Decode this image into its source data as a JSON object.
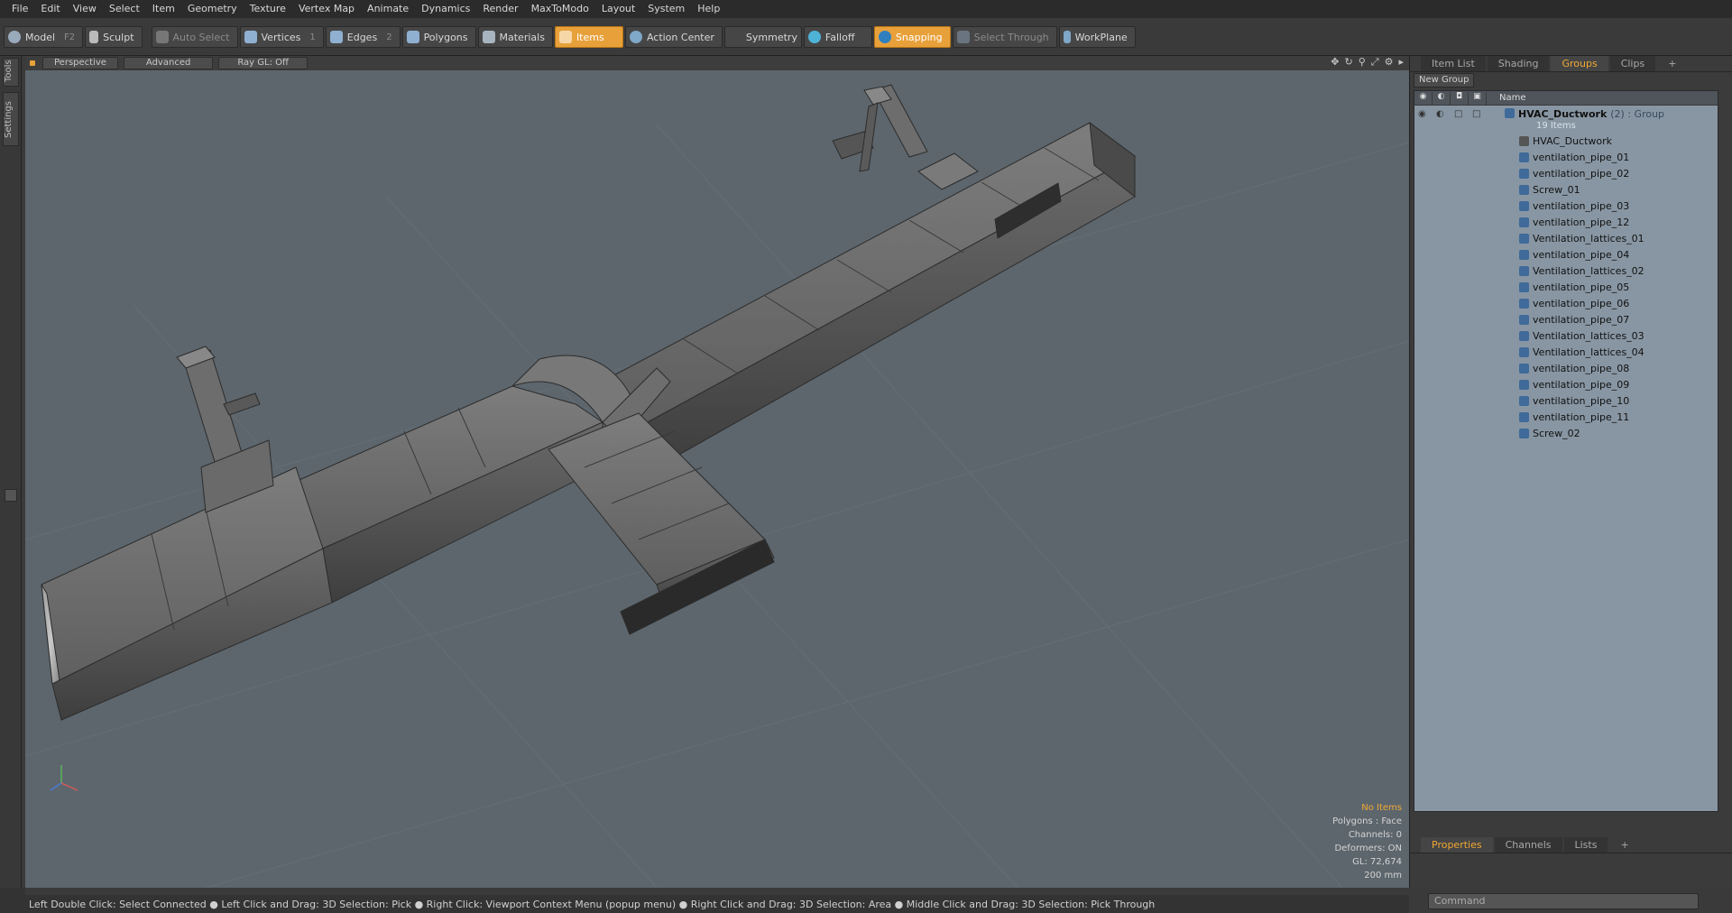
{
  "menu": [
    "File",
    "Edit",
    "View",
    "Select",
    "Item",
    "Geometry",
    "Texture",
    "Vertex Map",
    "Animate",
    "Dynamics",
    "Render",
    "MaxToModo",
    "Layout",
    "System",
    "Help"
  ],
  "toolbar": {
    "model": "Model",
    "model_key": "F2",
    "sculpt": "Sculpt",
    "auto_select": "Auto Select",
    "vertices": "Vertices",
    "vertices_key": "1",
    "edges": "Edges",
    "edges_key": "2",
    "polygons": "Polygons",
    "materials": "Materials",
    "items": "Items",
    "action_center": "Action Center",
    "symmetry": "Symmetry",
    "falloff": "Falloff",
    "snapping": "Snapping",
    "select_through": "Select Through",
    "workplane": "WorkPlane"
  },
  "left_tabs": [
    "Tools",
    "Settings"
  ],
  "viewport": {
    "view": "Perspective",
    "mode": "Advanced",
    "raygl": "Ray GL: Off",
    "info": {
      "selection": "No Items",
      "polygons": "Polygons : Face",
      "channels": "Channels: 0",
      "deformers": "Deformers: ON",
      "gl": "GL: 72,674",
      "scale": "200 mm"
    }
  },
  "right_panel": {
    "tabs": [
      "Item List",
      "Shading",
      "Groups",
      "Clips"
    ],
    "active_tab": "Groups",
    "new_group": "New Group",
    "name_header": "Name",
    "group": {
      "name": "HVAC_Ductwork",
      "suffix": "(2) : Group",
      "count": "19 Items"
    },
    "items": [
      "HVAC_Ductwork",
      "ventilation_pipe_01",
      "ventilation_pipe_02",
      "Screw_01",
      "ventilation_pipe_03",
      "ventilation_pipe_12",
      "Ventilation_lattices_01",
      "ventilation_pipe_04",
      "Ventilation_lattices_02",
      "ventilation_pipe_05",
      "ventilation_pipe_06",
      "ventilation_pipe_07",
      "Ventilation_lattices_03",
      "Ventilation_lattices_04",
      "ventilation_pipe_08",
      "ventilation_pipe_09",
      "ventilation_pipe_10",
      "ventilation_pipe_11",
      "Screw_02"
    ],
    "bottom_tabs": [
      "Properties",
      "Channels",
      "Lists"
    ],
    "command_placeholder": "Command"
  },
  "status": "Left Double Click: Select Connected ● Left Click and Drag: 3D Selection: Pick ● Right Click: Viewport Context Menu (popup menu) ● Right Click and Drag: 3D Selection: Area ● Middle Click and Drag: 3D Selection: Pick Through"
}
